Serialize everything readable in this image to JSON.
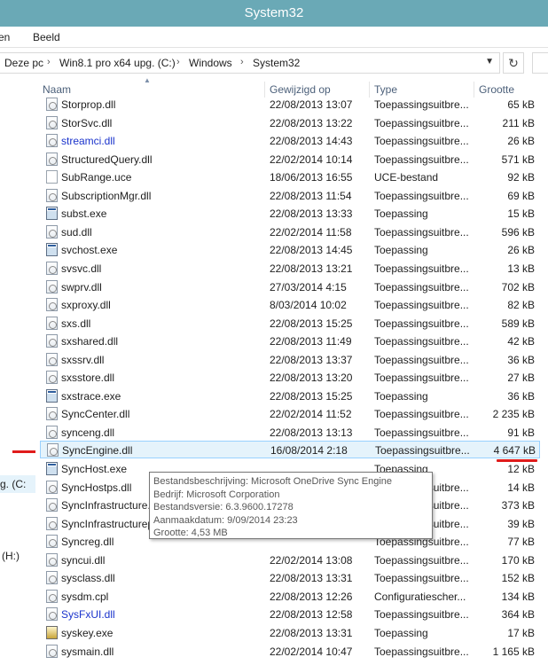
{
  "window": {
    "title": "System32"
  },
  "ribbon": {
    "tabs": [
      "en",
      "Beeld"
    ]
  },
  "address": {
    "crumbs": [
      "Deze pc",
      "Win8.1 pro x64 upg. (C:)",
      "Windows",
      "System32"
    ],
    "refresh_icon": "refresh-icon"
  },
  "nav": {
    "drive_label": "g. (C:",
    "drive_h": "(H:)"
  },
  "columns": {
    "name": "Naam",
    "date": "Gewijzigd op",
    "type": "Type",
    "size": "Grootte"
  },
  "files": [
    {
      "name": "Storprop.dll",
      "date": "22/08/2013 13:07",
      "type": "Toepassingsuitbre...",
      "size": "65 kB",
      "icon": "dll",
      "blue": false
    },
    {
      "name": "StorSvc.dll",
      "date": "22/08/2013 13:22",
      "type": "Toepassingsuitbre...",
      "size": "211 kB",
      "icon": "dll",
      "blue": false
    },
    {
      "name": "streamci.dll",
      "date": "22/08/2013 14:43",
      "type": "Toepassingsuitbre...",
      "size": "26 kB",
      "icon": "dll",
      "blue": true
    },
    {
      "name": "StructuredQuery.dll",
      "date": "22/02/2014 10:14",
      "type": "Toepassingsuitbre...",
      "size": "571 kB",
      "icon": "dll",
      "blue": false
    },
    {
      "name": "SubRange.uce",
      "date": "18/06/2013 16:55",
      "type": "UCE-bestand",
      "size": "92 kB",
      "icon": "file",
      "blue": false
    },
    {
      "name": "SubscriptionMgr.dll",
      "date": "22/08/2013 11:54",
      "type": "Toepassingsuitbre...",
      "size": "69 kB",
      "icon": "dll",
      "blue": false
    },
    {
      "name": "subst.exe",
      "date": "22/08/2013 13:33",
      "type": "Toepassing",
      "size": "15 kB",
      "icon": "exe",
      "blue": false
    },
    {
      "name": "sud.dll",
      "date": "22/02/2014 11:58",
      "type": "Toepassingsuitbre...",
      "size": "596 kB",
      "icon": "dll",
      "blue": false
    },
    {
      "name": "svchost.exe",
      "date": "22/08/2013 14:45",
      "type": "Toepassing",
      "size": "26 kB",
      "icon": "exe",
      "blue": false
    },
    {
      "name": "svsvc.dll",
      "date": "22/08/2013 13:21",
      "type": "Toepassingsuitbre...",
      "size": "13 kB",
      "icon": "dll",
      "blue": false
    },
    {
      "name": "swprv.dll",
      "date": "27/03/2014 4:15",
      "type": "Toepassingsuitbre...",
      "size": "702 kB",
      "icon": "dll",
      "blue": false
    },
    {
      "name": "sxproxy.dll",
      "date": "8/03/2014 10:02",
      "type": "Toepassingsuitbre...",
      "size": "82 kB",
      "icon": "dll",
      "blue": false
    },
    {
      "name": "sxs.dll",
      "date": "22/08/2013 15:25",
      "type": "Toepassingsuitbre...",
      "size": "589 kB",
      "icon": "dll",
      "blue": false
    },
    {
      "name": "sxshared.dll",
      "date": "22/08/2013 11:49",
      "type": "Toepassingsuitbre...",
      "size": "42 kB",
      "icon": "dll",
      "blue": false
    },
    {
      "name": "sxssrv.dll",
      "date": "22/08/2013 13:37",
      "type": "Toepassingsuitbre...",
      "size": "36 kB",
      "icon": "dll",
      "blue": false
    },
    {
      "name": "sxsstore.dll",
      "date": "22/08/2013 13:20",
      "type": "Toepassingsuitbre...",
      "size": "27 kB",
      "icon": "dll",
      "blue": false
    },
    {
      "name": "sxstrace.exe",
      "date": "22/08/2013 15:25",
      "type": "Toepassing",
      "size": "36 kB",
      "icon": "exe",
      "blue": false
    },
    {
      "name": "SyncCenter.dll",
      "date": "22/02/2014 11:52",
      "type": "Toepassingsuitbre...",
      "size": "2 235 kB",
      "icon": "dll",
      "blue": false
    },
    {
      "name": "synceng.dll",
      "date": "22/08/2013 13:13",
      "type": "Toepassingsuitbre...",
      "size": "91 kB",
      "icon": "dll",
      "blue": false
    },
    {
      "name": "SyncEngine.dll",
      "date": "16/08/2014 2:18",
      "type": "Toepassingsuitbre...",
      "size": "4 647 kB",
      "icon": "dll",
      "blue": false,
      "selected": true
    },
    {
      "name": "SyncHost.exe",
      "date": "",
      "type": "Toepassing",
      "size": "12 kB",
      "icon": "exe",
      "blue": false
    },
    {
      "name": "SyncHostps.dll",
      "date": "",
      "type": "Toepassingsuitbre...",
      "size": "14 kB",
      "icon": "dll",
      "blue": false
    },
    {
      "name": "SyncInfrastructure.",
      "date": "",
      "type": "Toepassingsuitbre...",
      "size": "373 kB",
      "icon": "dll",
      "blue": false
    },
    {
      "name": "SyncInfrastructurep",
      "date": "",
      "type": "Toepassingsuitbre...",
      "size": "39 kB",
      "icon": "dll",
      "blue": false
    },
    {
      "name": "Syncreg.dll",
      "date": "",
      "type": "Toepassingsuitbre...",
      "size": "77 kB",
      "icon": "dll",
      "blue": false
    },
    {
      "name": "syncui.dll",
      "date": "22/02/2014 13:08",
      "type": "Toepassingsuitbre...",
      "size": "170 kB",
      "icon": "dll",
      "blue": false
    },
    {
      "name": "sysclass.dll",
      "date": "22/08/2013 13:31",
      "type": "Toepassingsuitbre...",
      "size": "152 kB",
      "icon": "dll",
      "blue": false
    },
    {
      "name": "sysdm.cpl",
      "date": "22/08/2013 12:26",
      "type": "Configuratiescher...",
      "size": "134 kB",
      "icon": "dll",
      "blue": false
    },
    {
      "name": "SysFxUI.dll",
      "date": "22/08/2013 12:58",
      "type": "Toepassingsuitbre...",
      "size": "364 kB",
      "icon": "dll",
      "blue": true
    },
    {
      "name": "syskey.exe",
      "date": "22/08/2013 13:31",
      "type": "Toepassing",
      "size": "17 kB",
      "icon": "key",
      "blue": false
    },
    {
      "name": "sysmain.dll",
      "date": "22/02/2014 10:47",
      "type": "Toepassingsuitbre...",
      "size": "1 165 kB",
      "icon": "dll",
      "blue": false
    }
  ],
  "tooltip": {
    "description": "Bestandsbeschrijving: Microsoft OneDrive Sync Engine",
    "company": "Bedrijf: Microsoft Corporation",
    "version": "Bestandsversie: 6.3.9600.17278",
    "created": "Aanmaakdatum: 9/09/2014 23:23",
    "size": "Grootte: 4,53 MB"
  },
  "annotations": {
    "color": "#e01b1b"
  }
}
